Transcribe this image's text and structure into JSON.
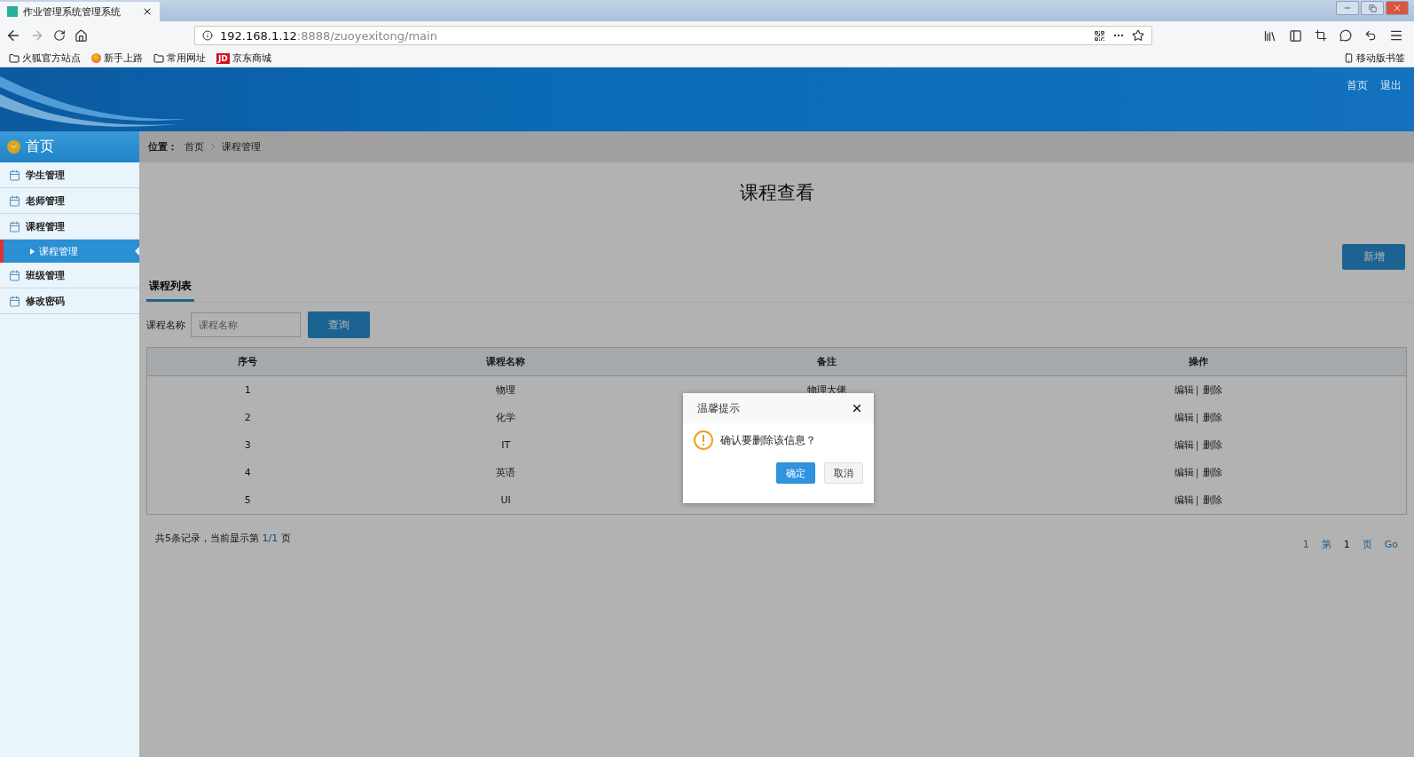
{
  "browser": {
    "tab": {
      "title": "作业管理系统管理系统",
      "selected": true
    },
    "url": {
      "host": "192.168.1.12",
      "rest": ":8888/zuoyexitong/main"
    },
    "bookmarks": [
      {
        "kind": "folder",
        "label": "火狐官方站点"
      },
      {
        "kind": "firefox",
        "label": "新手上路"
      },
      {
        "kind": "folder",
        "label": "常用网址"
      },
      {
        "kind": "jd",
        "icon_text": "JD",
        "label": "京东商城"
      }
    ],
    "mobile_bookmarks": "移动版书签"
  },
  "header": {
    "links": [
      "首页",
      "退出"
    ]
  },
  "sidebar": {
    "title": "首页",
    "items": [
      {
        "label": "学生管理",
        "selected": false
      },
      {
        "label": "老师管理",
        "selected": false
      },
      {
        "label": "课程管理",
        "selected": false,
        "children": [
          {
            "label": "课程管理",
            "selected": true
          }
        ]
      },
      {
        "label": "班级管理",
        "selected": false
      },
      {
        "label": "修改密码",
        "selected": false
      }
    ]
  },
  "breadcrumb": {
    "label": "位置：",
    "items": [
      "首页",
      "课程管理"
    ]
  },
  "page": {
    "title": "课程查看",
    "add_button": "新增",
    "tabs": [
      {
        "label": "课程列表",
        "selected": true
      }
    ],
    "search": {
      "label": "课程名称",
      "placeholder": "课程名称",
      "button": "查询"
    },
    "table": {
      "columns": [
        "序号",
        "课程名称",
        "备注",
        "操作"
      ],
      "rows": [
        {
          "cells": [
            "1",
            "物理",
            "物理大佬"
          ],
          "actions": [
            "编辑",
            "删除"
          ]
        },
        {
          "cells": [
            "2",
            "化学",
            ""
          ],
          "actions": [
            "编辑",
            "删除"
          ]
        },
        {
          "cells": [
            "3",
            "IT",
            ""
          ],
          "actions": [
            "编辑",
            "删除"
          ]
        },
        {
          "cells": [
            "4",
            "英语",
            ""
          ],
          "actions": [
            "编辑",
            "删除"
          ]
        },
        {
          "cells": [
            "5",
            "UI",
            ""
          ],
          "actions": [
            "编辑",
            "删除"
          ]
        }
      ]
    },
    "summary": {
      "prefix": "共5条记录，当前显示第 ",
      "pages": "1/1",
      "suffix": " 页"
    },
    "pagination": {
      "first": "1",
      "prefix": "第",
      "page": "1",
      "suffix": "页",
      "go": "Go"
    }
  },
  "dialog": {
    "title": "温馨提示",
    "message": "确认要删除该信息？",
    "buttons": [
      {
        "label": "确定",
        "kind": "primary"
      },
      {
        "label": "取消",
        "kind": "secondary"
      }
    ]
  }
}
